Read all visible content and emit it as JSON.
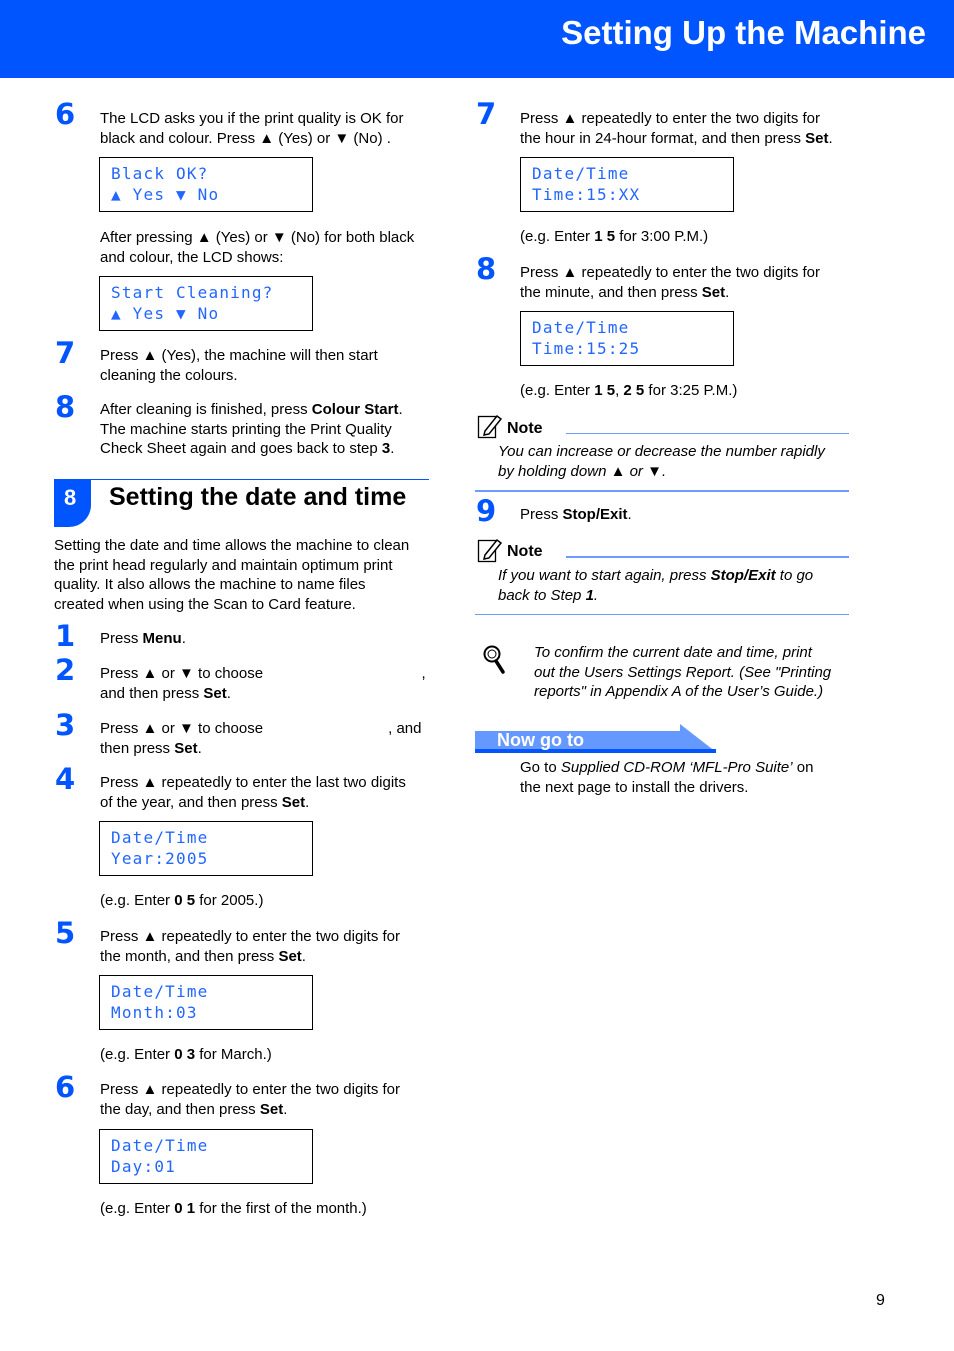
{
  "header": {
    "title": "Setting Up the Machine",
    "color": "#0055ff"
  },
  "left": {
    "s6": {
      "num": "6",
      "text": [
        {
          "t": "The LCD asks you if the print quality is OK for"
        },
        {
          "br": 1
        },
        {
          "t": "black and colour. Press ▲ (Yes) or ▼ (No) ."
        }
      ],
      "lcd": [
        "Black OK?",
        "▲ Yes ▼ No"
      ]
    },
    "after": {
      "text": [
        {
          "t": "After pressing ▲ (Yes) or ▼ (No) for both black"
        },
        {
          "br": 1
        },
        {
          "t": "and colour, the LCD shows:"
        }
      ],
      "lcd": [
        "Start Cleaning?",
        "▲ Yes ▼ No"
      ]
    },
    "s7": {
      "num": "7",
      "text": [
        {
          "t": "Press ▲ (Yes), the machine will then start"
        },
        {
          "br": 1
        },
        {
          "t": "cleaning the colours."
        }
      ]
    },
    "s8": {
      "num": "8",
      "text": [
        {
          "t": "After cleaning is finished, press "
        },
        {
          "t": "Colour Start",
          "b": 1
        },
        {
          "t": "."
        },
        {
          "br": 1
        },
        {
          "t": "The machine starts printing the Print Quality"
        },
        {
          "br": 1
        },
        {
          "t": "Check Sheet again and goes back to step "
        },
        {
          "t": "3",
          "b": 1
        },
        {
          "t": "."
        }
      ]
    },
    "section": {
      "number": "8",
      "title": "Setting the date and time",
      "intro": [
        {
          "t": "Setting the date and time allows the machine to clean"
        },
        {
          "br": 1
        },
        {
          "t": "the print head regularly and maintain optimum print"
        },
        {
          "br": 1
        },
        {
          "t": "quality. It also allows the machine to name files"
        },
        {
          "br": 1
        },
        {
          "t": "created when using the Scan to Card feature."
        }
      ]
    },
    "d1": {
      "num": "1",
      "text": [
        {
          "t": "Press "
        },
        {
          "t": "Menu",
          "b": 1
        },
        {
          "t": "."
        }
      ]
    },
    "d2": {
      "num": "2",
      "text": [
        {
          "t": "Press ▲ or ▼ to choose                                      ,"
        },
        {
          "br": 1
        },
        {
          "t": "and then press "
        },
        {
          "t": "Set",
          "b": 1
        },
        {
          "t": "."
        }
      ]
    },
    "d3": {
      "num": "3",
      "text": [
        {
          "t": "Press ▲ or ▼ to choose                              , and"
        },
        {
          "br": 1
        },
        {
          "t": "then press "
        },
        {
          "t": "Set",
          "b": 1
        },
        {
          "t": "."
        }
      ]
    },
    "d4": {
      "num": "4",
      "text": [
        {
          "t": "Press ▲ repeatedly to enter the last two digits"
        },
        {
          "br": 1
        },
        {
          "t": "of the year, and then press "
        },
        {
          "t": "Set",
          "b": 1
        },
        {
          "t": "."
        }
      ],
      "lcd": [
        "Date/Time",
        "Year:2005"
      ],
      "eg": [
        {
          "t": "(e.g. Enter "
        },
        {
          "t": "0 5",
          "b": 1
        },
        {
          "t": " for 2005.)"
        }
      ]
    },
    "d5": {
      "num": "5",
      "text": [
        {
          "t": "Press ▲ repeatedly to enter the two digits for"
        },
        {
          "br": 1
        },
        {
          "t": "the month, and then press "
        },
        {
          "t": "Set",
          "b": 1
        },
        {
          "t": "."
        }
      ],
      "lcd": [
        "Date/Time",
        "Month:03"
      ],
      "eg": [
        {
          "t": "(e.g. Enter "
        },
        {
          "t": "0 3",
          "b": 1
        },
        {
          "t": " for March.)"
        }
      ]
    },
    "d6": {
      "num": "6",
      "text": [
        {
          "t": "Press ▲ repeatedly to enter the two digits for"
        },
        {
          "br": 1
        },
        {
          "t": "the day, and then press "
        },
        {
          "t": "Set",
          "b": 1
        },
        {
          "t": "."
        }
      ],
      "lcd": [
        "Date/Time",
        "Day:01"
      ],
      "eg": [
        {
          "t": "(e.g. Enter "
        },
        {
          "t": "0 1",
          "b": 1
        },
        {
          "t": " for the first of the month.)"
        }
      ]
    }
  },
  "right": {
    "d7": {
      "num": "7",
      "text": [
        {
          "t": "Press ▲ repeatedly to enter the two digits for"
        },
        {
          "br": 1
        },
        {
          "t": "the hour in 24-hour format, and then press "
        },
        {
          "t": "Set",
          "b": 1
        },
        {
          "t": "."
        }
      ],
      "lcd": [
        "Date/Time",
        "Time:15:XX"
      ],
      "eg": [
        {
          "t": "(e.g. Enter "
        },
        {
          "t": "1 5",
          "b": 1
        },
        {
          "t": " for 3:00 P.M.)"
        }
      ]
    },
    "d8": {
      "num": "8",
      "text": [
        {
          "t": "Press ▲ repeatedly to enter the two digits for"
        },
        {
          "br": 1
        },
        {
          "t": "the minute, and then press "
        },
        {
          "t": "Set",
          "b": 1
        },
        {
          "t": "."
        }
      ],
      "lcd": [
        "Date/Time",
        "Time:15:25"
      ],
      "eg": [
        {
          "t": "(e.g. Enter "
        },
        {
          "t": "1 5",
          "b": 1
        },
        {
          "t": ", "
        },
        {
          "t": "2 5",
          "b": 1
        },
        {
          "t": " for 3:25 P.M.)"
        }
      ]
    },
    "note1": {
      "label": "Note",
      "text": [
        {
          "t": "You can increase or decrease the number rapidly"
        },
        {
          "br": 1
        },
        {
          "t": "by holding down ▲ or ▼."
        }
      ]
    },
    "d9": {
      "num": "9",
      "text": [
        {
          "t": "Press "
        },
        {
          "t": "Stop/Exit",
          "b": 1
        },
        {
          "t": "."
        }
      ]
    },
    "note2": {
      "label": "Note",
      "text": [
        {
          "t": "If you want to start again, press "
        },
        {
          "t": "Stop/Exit",
          "b": 1
        },
        {
          "t": " to go"
        },
        {
          "br": 1
        },
        {
          "t": "back to Step "
        },
        {
          "t": "1",
          "b": 1
        },
        {
          "t": "."
        }
      ]
    },
    "tip": {
      "icon": "magnifier-icon",
      "text": [
        {
          "t": "To confirm the current date and time, print"
        },
        {
          "br": 1
        },
        {
          "t": "out the Users Settings Report. (See \"Printing"
        },
        {
          "br": 1
        },
        {
          "t": "reports\" in Appendix A of the User’s Guide.)"
        }
      ]
    },
    "nowgo": {
      "label": "Now go to",
      "text": [
        {
          "t": "Go to "
        },
        {
          "t": "Supplied CD-ROM ‘MFL-Pro Suite’",
          "i": 1
        },
        {
          "t": " on"
        },
        {
          "br": 1
        },
        {
          "t": "the next page to install the drivers."
        }
      ]
    }
  },
  "page_number": "9"
}
